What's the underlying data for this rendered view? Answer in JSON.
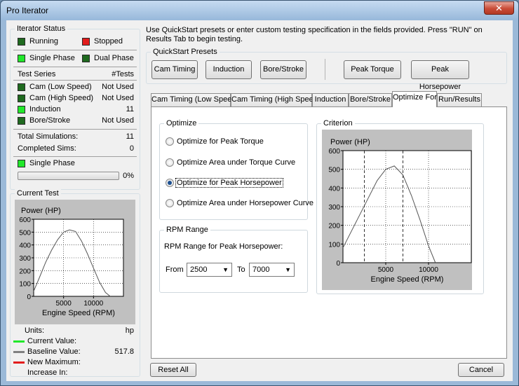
{
  "window": {
    "title": "Pro Iterator",
    "close_glyph": "✕"
  },
  "status": {
    "heading": "Iterator Status",
    "running": "Running",
    "stopped": "Stopped",
    "single_phase": "Single Phase",
    "dual_phase": "Dual Phase"
  },
  "test_series": {
    "header_label": "Test Series",
    "header_count": "#Tests",
    "rows": [
      {
        "label": "Cam (Low Speed)",
        "value": "Not Used"
      },
      {
        "label": "Cam (High Speed)",
        "value": "Not Used"
      },
      {
        "label": "Induction",
        "value": "11"
      },
      {
        "label": "Bore/Stroke",
        "value": "Not Used"
      }
    ],
    "total_label": "Total Simulations:",
    "total_value": "11",
    "completed_label": "Completed Sims:",
    "completed_value": "0",
    "phase_label": "Single Phase",
    "progress_text": "0%",
    "progress_fraction": 0
  },
  "current_test": {
    "heading": "Current Test",
    "units_label": "Units:",
    "units_value": "hp",
    "current_value_label": "Current Value:",
    "baseline_label": "Baseline Value:",
    "baseline_value": "517.8",
    "new_max_label": "New Maximum:",
    "increase_label": "Increase In:"
  },
  "instructions": "Use QuickStart presets or enter custom testing specification in the fields provided. Press \"RUN\" on Results Tab to begin testing.",
  "quickstart": {
    "heading": "QuickStart Presets",
    "buttons": [
      "Cam Timing",
      "Induction",
      "Bore/Stroke",
      "Peak Torque",
      "Peak Horsepower"
    ]
  },
  "tabs": [
    "Cam Timing (Low Speed)",
    "Cam Timing (High Speed)",
    "Induction",
    "Bore/Stroke",
    "Optimize For",
    "Run/Results"
  ],
  "active_tab": "Optimize For",
  "optimize": {
    "heading": "Optimize",
    "options": [
      "Optimize for Peak Torque",
      "Optimize Area under Torque Curve",
      "Optimize for Peak Horsepower",
      "Optimize Area under Horsepower Curve"
    ],
    "selected_index": 2
  },
  "rpm_range": {
    "heading": "RPM Range",
    "subtitle": "RPM Range for Peak Horsepower:",
    "from_label": "From",
    "from_value": "2500",
    "to_label": "To",
    "to_value": "7000"
  },
  "criterion": {
    "heading": "Criterion"
  },
  "buttons": {
    "reset_all": "Reset All",
    "cancel": "Cancel"
  },
  "colors": {
    "current_value": "#21e82a",
    "baseline_value": "#808080",
    "new_maximum": "#e21c1c"
  },
  "chart_data": [
    {
      "type": "line",
      "title": "Power (HP)",
      "xlabel": "Engine Speed (RPM)",
      "ylabel": "Power (HP)",
      "xlim": [
        0,
        15000
      ],
      "ylim": [
        0,
        600
      ],
      "xticks": [
        5000,
        10000
      ],
      "yticks": [
        0,
        100,
        200,
        300,
        400,
        500,
        600
      ],
      "grid": true,
      "series": [
        {
          "x": [
            0,
            1000,
            2000,
            3000,
            4000,
            5000,
            6000,
            7000,
            8000,
            9000,
            10000,
            11000,
            12000,
            12800
          ],
          "y": [
            40,
            150,
            265,
            360,
            440,
            500,
            517.8,
            505,
            430,
            330,
            220,
            110,
            30,
            0
          ]
        }
      ]
    },
    {
      "type": "line",
      "title": "Power (HP)",
      "xlabel": "Engine Speed (RPM)",
      "ylabel": "Power (HP)",
      "xlim": [
        0,
        15000
      ],
      "ylim": [
        0,
        600
      ],
      "xticks": [
        5000,
        10000
      ],
      "yticks": [
        0,
        100,
        200,
        300,
        400,
        500,
        600
      ],
      "grid": true,
      "markers_x": [
        2500,
        7000
      ],
      "series": [
        {
          "x": [
            0,
            1000,
            2000,
            3000,
            4000,
            5000,
            6000,
            7000,
            8000,
            9000,
            10000,
            10800
          ],
          "y": [
            80,
            170,
            260,
            350,
            440,
            500,
            517.8,
            470,
            360,
            230,
            90,
            0
          ]
        }
      ]
    }
  ]
}
